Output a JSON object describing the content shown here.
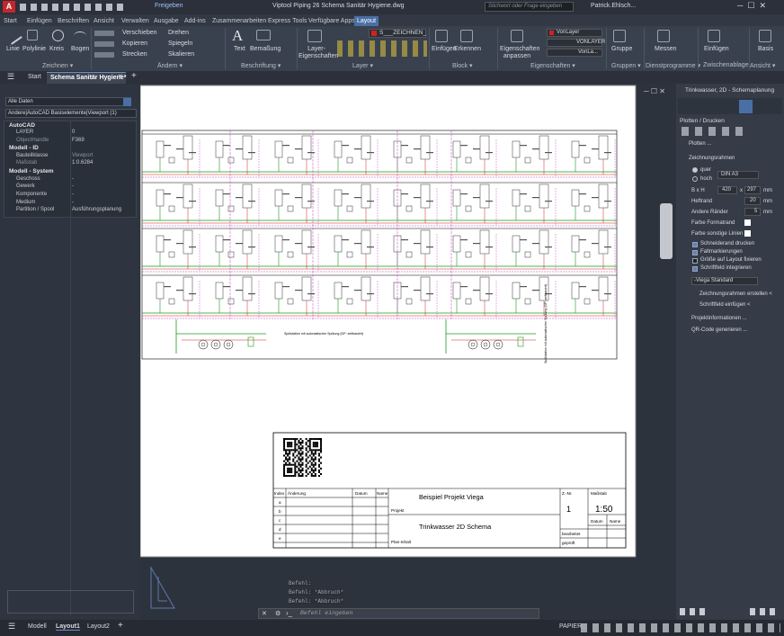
{
  "app": {
    "title": "Viptool Piping 26   Schema Sanitär Hygiene.dwg",
    "share": "Freigeben",
    "search_placeholder": "Stichwort oder Frage eingeben",
    "user": "Patrick.Ehlsch..."
  },
  "ribbon_tabs": [
    "Start",
    "Einfügen",
    "Beschriften",
    "Ansicht",
    "Verwalten",
    "Ausgabe",
    "Add-ins",
    "Zusammenarbeiten",
    "Express Tools",
    "Verfügbare Apps",
    "Layout"
  ],
  "ribbon": {
    "draw": {
      "linie": "Linie",
      "polylinie": "Polylinie",
      "kreis": "Kreis",
      "bogen": "Bogen",
      "group": "Zeichnen ▾"
    },
    "modify": {
      "verschieben": "Verschieben",
      "drehen": "Drehen",
      "kopieren": "Kopieren",
      "spiegeln": "Spiegeln",
      "strecken": "Strecken",
      "skalieren": "Skalieren",
      "group": "Ändern ▾"
    },
    "annot": {
      "text": "Text",
      "bemassung": "Bemaßung",
      "group": "Beschriftung ▾"
    },
    "layer": {
      "props": "Layer-Eigenschaften",
      "current": "S___ZEICHNEN_",
      "group": "Layer ▾"
    },
    "block": {
      "einfuegen": "Einfügen",
      "erkennen": "Erkennen",
      "group": "Block ▾"
    },
    "props": {
      "anpassen": "Eigenschaften anpassen",
      "vonlayer1": "VonLayer",
      "vonlayer2": "VONLAYER",
      "vonlayer3": "VonLa...",
      "group": "Eigenschaften ▾"
    },
    "groups": {
      "gruppe": "Gruppe",
      "group": "Gruppen ▾"
    },
    "util": {
      "messen": "Messen",
      "group": "Dienstprogramme ▾"
    },
    "clip": {
      "einfuegen": "Einfügen",
      "group": "Zwischenablage"
    },
    "view": {
      "basis": "Basis",
      "group": "Ansicht ▾"
    }
  },
  "doc_tabs": {
    "start": "Start",
    "active": "Schema Sanitär Hygiene*"
  },
  "left_panel": {
    "filter": "Alle Daten",
    "context": "Andere|AutoCAD Basiselemente|Viewport (1)",
    "sections": [
      {
        "title": "AutoCAD",
        "rows": [
          [
            "LAYER",
            "0"
          ],
          [
            "ObjectHandle",
            "F369"
          ]
        ]
      },
      {
        "title": "Modell - ID",
        "rows": [
          [
            "Bauteilklasse",
            "Viewport"
          ],
          [
            "Maßstab",
            "1:0.6284"
          ]
        ]
      },
      {
        "title": "Modell - System",
        "rows": [
          [
            "Geschoss",
            "-"
          ],
          [
            "Gewerk",
            "-"
          ],
          [
            "Komponente",
            "-"
          ],
          [
            "Medium",
            "-"
          ],
          [
            "Partition / Spool",
            "Ausführungsplanung"
          ]
        ]
      }
    ]
  },
  "right_panel": {
    "title": "Trinkwasser, 2D - Schemaplanung",
    "section": "Plotten / Drucken",
    "plotten": "Plotten ...",
    "frame": "Zeichnungsrahmen",
    "quer": "quer",
    "hoch": "hoch",
    "format": "DIN A3",
    "bxh_label": "B x H",
    "b": "420",
    "h": "297",
    "x": "x",
    "unit": "mm",
    "heftrand_label": "Heftrand",
    "heftrand": "20",
    "raender_label": "Andere Ränder",
    "raender": "5",
    "farbe_formatrand": "Farbe Formatrand",
    "farbe_linien": "Farbe sonstige Linien",
    "checks": [
      "Schneiderand drucken",
      "Faltmarkierungen",
      "Größe auf Layout fixieren",
      "Schriftfeld integrieren"
    ],
    "checks_state": [
      true,
      true,
      false,
      true
    ],
    "stil": "-Viega Standard",
    "btn1": "Zeichnungsrahmen erstellen <",
    "btn2": "Schriftfeld einfügen <",
    "projinfo": "Projektinformationen ...",
    "qr": "QR-Code generieren ..."
  },
  "titleblock": {
    "index": "Index",
    "aenderung": "Änderung",
    "datum": "Datum",
    "name": "Name",
    "rows": [
      "a",
      "b",
      "c",
      "d",
      "e"
    ],
    "project_label": "Projekt",
    "project": "Beispiel Projekt Viega",
    "content": "Trinkwasser 2D Schema",
    "plan_label": "Plan-Inhalt",
    "znr_label": "Z.-Nr.",
    "znr": "1",
    "mass_label": "Maßstab",
    "mass": "1:50",
    "datum2": "Datum",
    "name2": "Name",
    "bearbeitet": "bearbeitet",
    "geprueft": "geprüft"
  },
  "schema_notes": {
    "left": "Spülstation mit automatischer Spülung (DP: zeitbasiert)",
    "right": "Spülstation mit automatischer Spülung (DP: zeitbasiert)"
  },
  "command": {
    "history": [
      "Befehl:",
      "Befehl: *Abbruch*",
      "Befehl: *Abbruch*"
    ],
    "placeholder": "Befehl eingeben"
  },
  "status": {
    "modell": "Modell",
    "layout1": "Layout1",
    "layout2": "Layout2",
    "papier": "PAPIER"
  },
  "colors": {
    "accent": "#4a6fa5",
    "green": "#1a9a1a",
    "red": "#d42020",
    "magenta": "#c23ac2"
  }
}
